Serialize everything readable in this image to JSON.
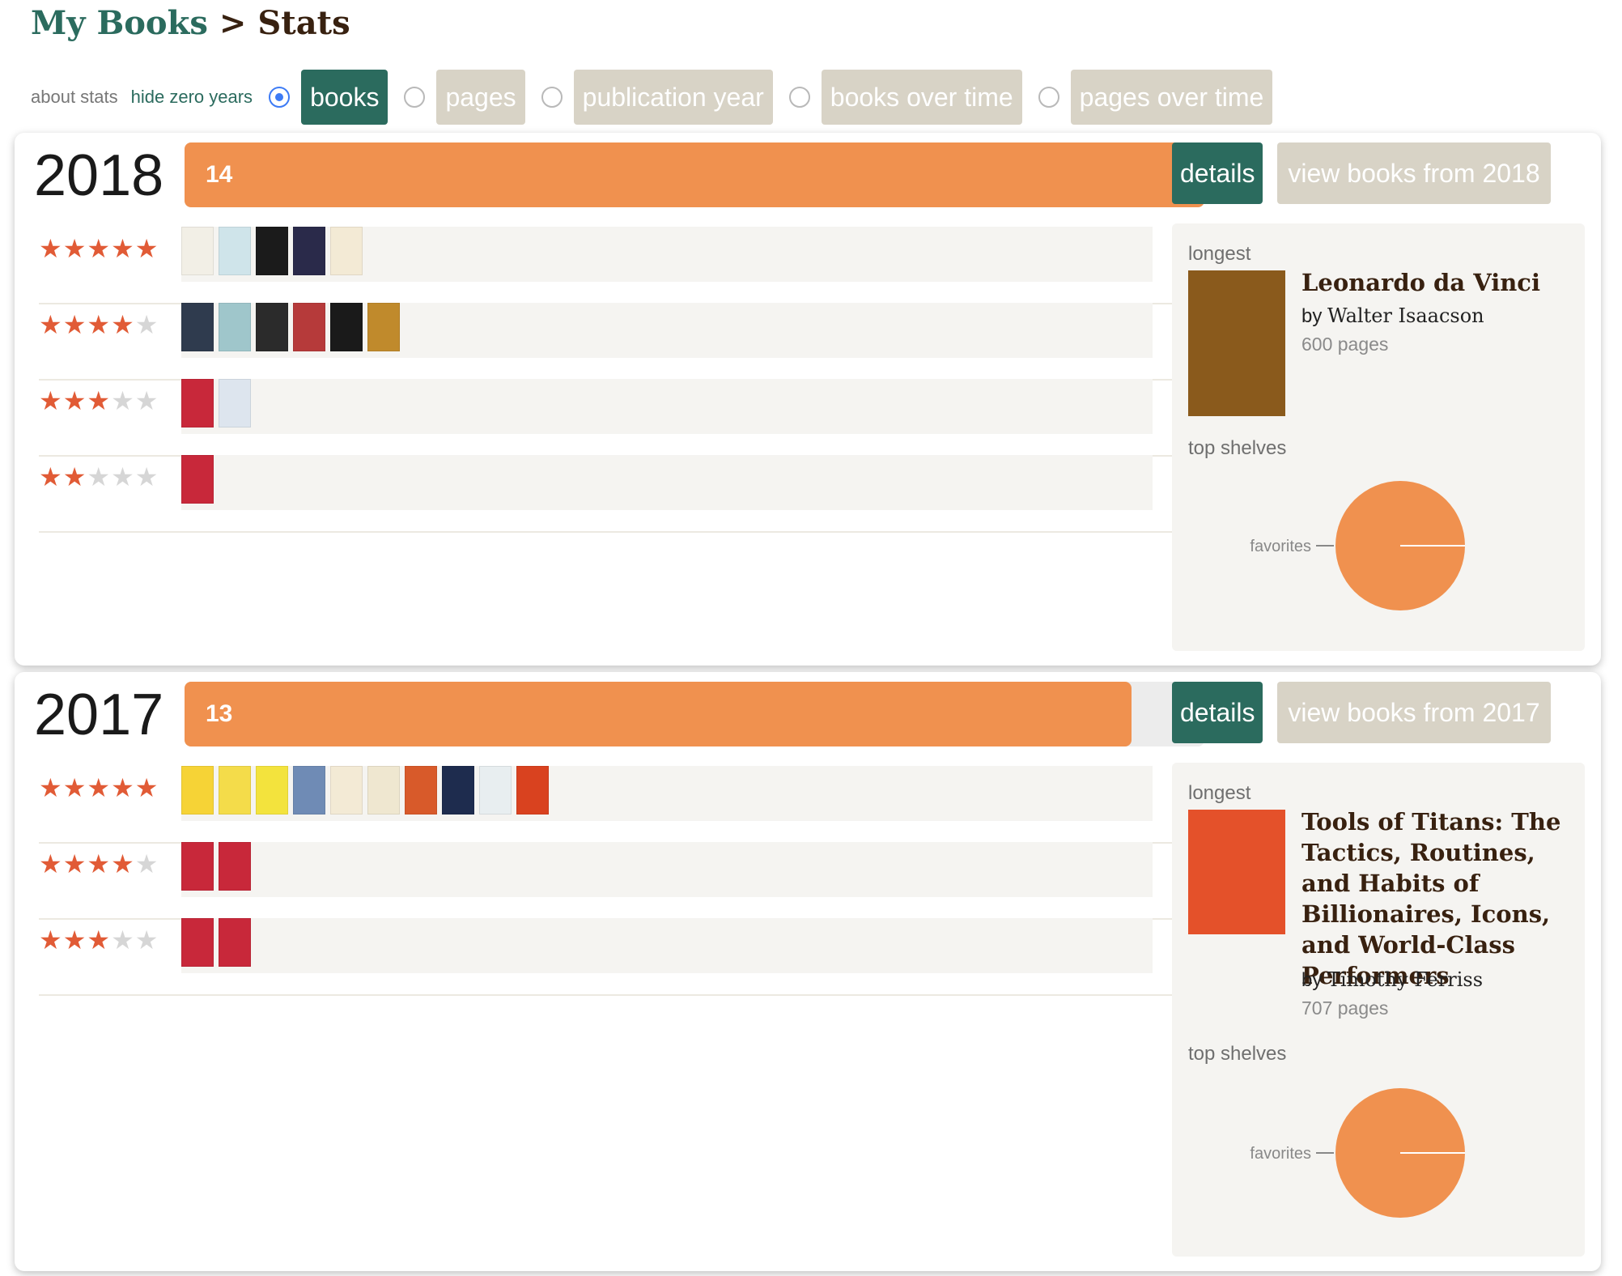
{
  "header": {
    "link": "My Books",
    "separator": ">",
    "current": "Stats"
  },
  "toolbar": {
    "about": "about stats",
    "hide_zero": "hide zero years",
    "tabs": [
      {
        "label": "books",
        "selected": true
      },
      {
        "label": "pages",
        "selected": false
      },
      {
        "label": "publication year",
        "selected": false
      },
      {
        "label": "books over time",
        "selected": false
      },
      {
        "label": "pages over time",
        "selected": false
      }
    ]
  },
  "colors": {
    "accent": "#2b6b5e",
    "bar": "#f0914f",
    "star": "#e15b36",
    "inactive_pill": "#d8d3c6"
  },
  "years": [
    {
      "year": "2018",
      "count": "14",
      "bar_fraction": 1.0,
      "details_label": "details",
      "view_label": "view books from 2018",
      "ratings": [
        {
          "stars": 5,
          "covers": [
            "#f2efe6",
            "#cfe4ea",
            "#1b1b1b",
            "#2a2a4a",
            "#f3ead5"
          ]
        },
        {
          "stars": 4,
          "covers": [
            "#2f3b4e",
            "#9fc6cb",
            "#2b2b2b",
            "#b63a3a",
            "#1a1a1a",
            "#c08a2c"
          ]
        },
        {
          "stars": 3,
          "covers": [
            "#c8283a",
            "#dde5ee"
          ]
        },
        {
          "stars": 2,
          "covers": [
            "#c8283a"
          ]
        }
      ],
      "longest": {
        "label": "longest",
        "title": "Leonardo da Vinci",
        "by": "by",
        "author": "Walter Isaacson",
        "pages": "600 pages",
        "cover_color": "#8a5a1c"
      },
      "top_shelves": {
        "label": "top shelves",
        "slices": [
          {
            "name": "favorites",
            "value": 100
          }
        ]
      }
    },
    {
      "year": "2017",
      "count": "13",
      "bar_fraction": 0.9286,
      "details_label": "details",
      "view_label": "view books from 2017",
      "ratings": [
        {
          "stars": 5,
          "covers": [
            "#f6d336",
            "#f4dc4a",
            "#f3e33d",
            "#6f8bb5",
            "#f3ead5",
            "#efe7d0",
            "#d85a2a",
            "#1e2c4e",
            "#e8eef0",
            "#d9421f"
          ]
        },
        {
          "stars": 4,
          "covers": [
            "#c8283a",
            "#c8283a"
          ]
        },
        {
          "stars": 3,
          "covers": [
            "#c8283a",
            "#c8283a"
          ]
        }
      ],
      "longest": {
        "label": "longest",
        "title": "Tools of Titans: The Tactics, Routines, and Habits of Billionaires, Icons, and World-Class Performers",
        "by": "by",
        "author": "Timothy Ferriss",
        "pages": "707 pages",
        "cover_color": "#e4512a"
      },
      "top_shelves": {
        "label": "top shelves",
        "slices": [
          {
            "name": "favorites",
            "value": 100
          }
        ]
      }
    }
  ]
}
